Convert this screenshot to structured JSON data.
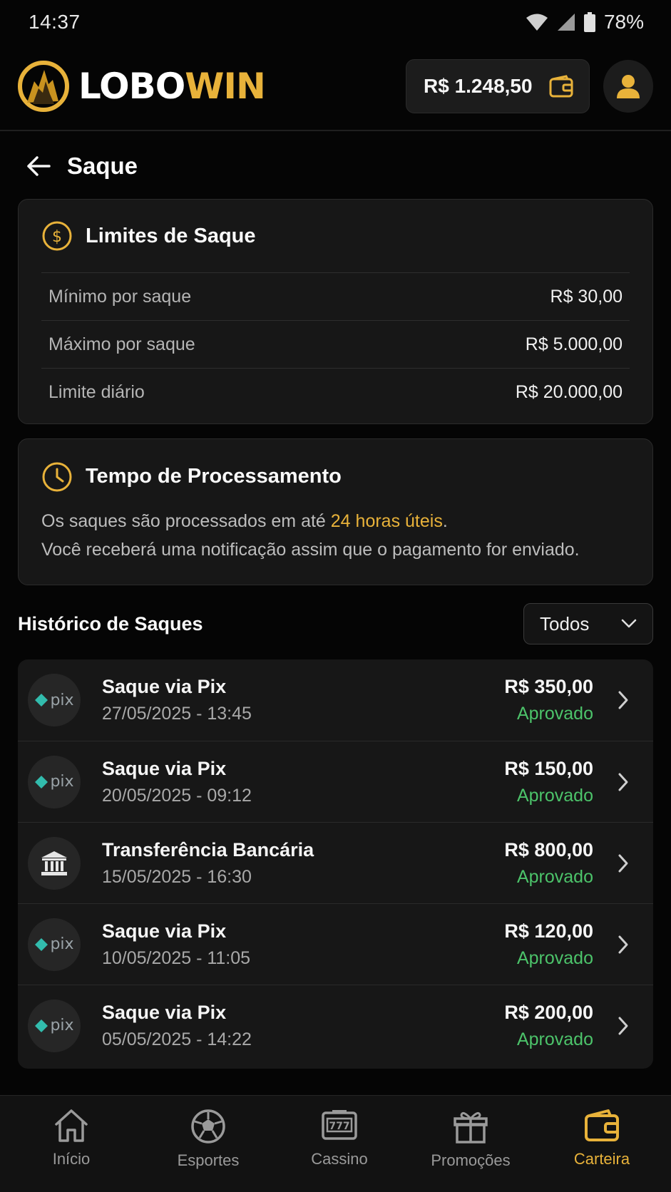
{
  "status_bar": {
    "time": "14:37",
    "battery": "78%"
  },
  "header": {
    "logo_part1": "LOBO",
    "logo_part2": "WIN",
    "balance": "R$ 1.248,50"
  },
  "page": {
    "title": "Saque"
  },
  "limits": {
    "title": "Limites de Saque",
    "rows": [
      {
        "label": "Mínimo por saque",
        "value": "R$ 30,00"
      },
      {
        "label": "Máximo por saque",
        "value": "R$ 5.000,00"
      },
      {
        "label": "Limite diário",
        "value": "R$ 20.000,00"
      }
    ]
  },
  "processing": {
    "title": "Tempo de Processamento",
    "line1_prefix": "Os saques são processados em até ",
    "line1_highlight": "24 horas úteis",
    "line1_suffix": ".",
    "line2": "Você receberá uma notificação assim que o pagamento for enviado."
  },
  "history": {
    "title": "Histórico de Saques",
    "filter_value": "Todos",
    "items": [
      {
        "method": "pix",
        "title": "Saque via Pix",
        "date": "27/05/2025 - 13:45",
        "amount": "R$ 350,00",
        "status": "Aprovado"
      },
      {
        "method": "pix",
        "title": "Saque via Pix",
        "date": "20/05/2025 - 09:12",
        "amount": "R$ 150,00",
        "status": "Aprovado"
      },
      {
        "method": "bank",
        "title": "Transferência Bancária",
        "date": "15/05/2025 - 16:30",
        "amount": "R$ 800,00",
        "status": "Aprovado"
      },
      {
        "method": "pix",
        "title": "Saque via Pix",
        "date": "10/05/2025 - 11:05",
        "amount": "R$ 120,00",
        "status": "Aprovado"
      },
      {
        "method": "pix",
        "title": "Saque via Pix",
        "date": "05/05/2025 - 14:22",
        "amount": "R$ 200,00",
        "status": "Aprovado"
      }
    ],
    "pix_label": "pix"
  },
  "nav": {
    "items": [
      {
        "label": "Início",
        "icon": "home-icon"
      },
      {
        "label": "Esportes",
        "icon": "soccer-ball-icon"
      },
      {
        "label": "Cassino",
        "icon": "slot-machine-icon"
      },
      {
        "label": "Promoções",
        "icon": "gift-icon"
      },
      {
        "label": "Carteira",
        "icon": "wallet-icon",
        "active": true
      }
    ]
  },
  "colors": {
    "accent": "#e8b23a",
    "success": "#4cc36a",
    "background": "#050505",
    "card": "#171717"
  }
}
